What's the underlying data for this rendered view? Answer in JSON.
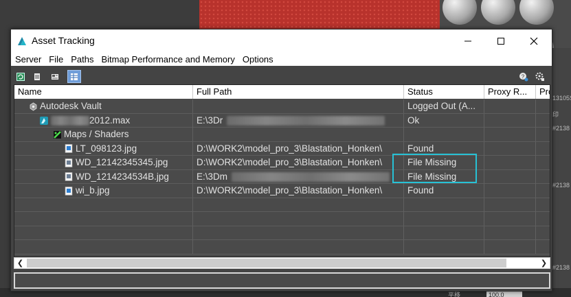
{
  "window": {
    "title": "Asset Tracking",
    "controls": {
      "minimize": "minimize",
      "maximize": "maximize",
      "close": "close"
    }
  },
  "menu": [
    "Server",
    "File",
    "Paths",
    "Bitmap Performance and Memory",
    "Options"
  ],
  "toolbar": {
    "left_icons": [
      "refresh-icon",
      "list-view-icon",
      "thumbnail-view-icon",
      "table-view-icon"
    ],
    "right_icons": [
      "help-icon",
      "settings-icon"
    ]
  },
  "table": {
    "columns": [
      "Name",
      "Full Path",
      "Status",
      "Proxy R...",
      "Pro"
    ],
    "rows": [
      {
        "indent": 0,
        "icon": "vault-icon",
        "name": "Autodesk Vault",
        "path": "",
        "status": "Logged Out (A..."
      },
      {
        "indent": 1,
        "icon": "max-file-icon",
        "name": "2012.max",
        "path": "E:\\3Dr",
        "status": "Ok"
      },
      {
        "indent": 2,
        "icon": "maps-folder-icon",
        "name": "Maps / Shaders",
        "path": "",
        "status": ""
      },
      {
        "indent": 3,
        "icon": "image-file-icon",
        "name": "LT_098123.jpg",
        "path": "D:\\WORK2\\model_pro_3\\Blastation_Honken\\",
        "status": "Found"
      },
      {
        "indent": 3,
        "icon": "image-missing-icon",
        "name": "WD_12142345345.jpg",
        "path": "D:\\WORK2\\model_pro_3\\Blastation_Honken\\",
        "status": "File Missing"
      },
      {
        "indent": 3,
        "icon": "image-missing-icon",
        "name": "WD_1214234534B.jpg",
        "path": "E:\\3Dm",
        "status": "File Missing"
      },
      {
        "indent": 3,
        "icon": "image-file-icon",
        "name": "wi_b.jpg",
        "path": "D:\\WORK2\\model_pro_3\\Blastation_Honken\\",
        "status": "Found"
      }
    ],
    "empty_rows": 5
  },
  "background": {
    "right_panel_texts": [
      "13105S",
      "印",
      "#2138",
      "#2138",
      "#2138"
    ],
    "bottom_label": "平移",
    "bottom_field": "100.0"
  },
  "colors": {
    "dialog_bg": "#444444",
    "grid_bg": "#4a4a4a",
    "highlight": "#27c2d6",
    "text": "#e2e2e2",
    "toolbar_active": "#6f9dd9"
  }
}
